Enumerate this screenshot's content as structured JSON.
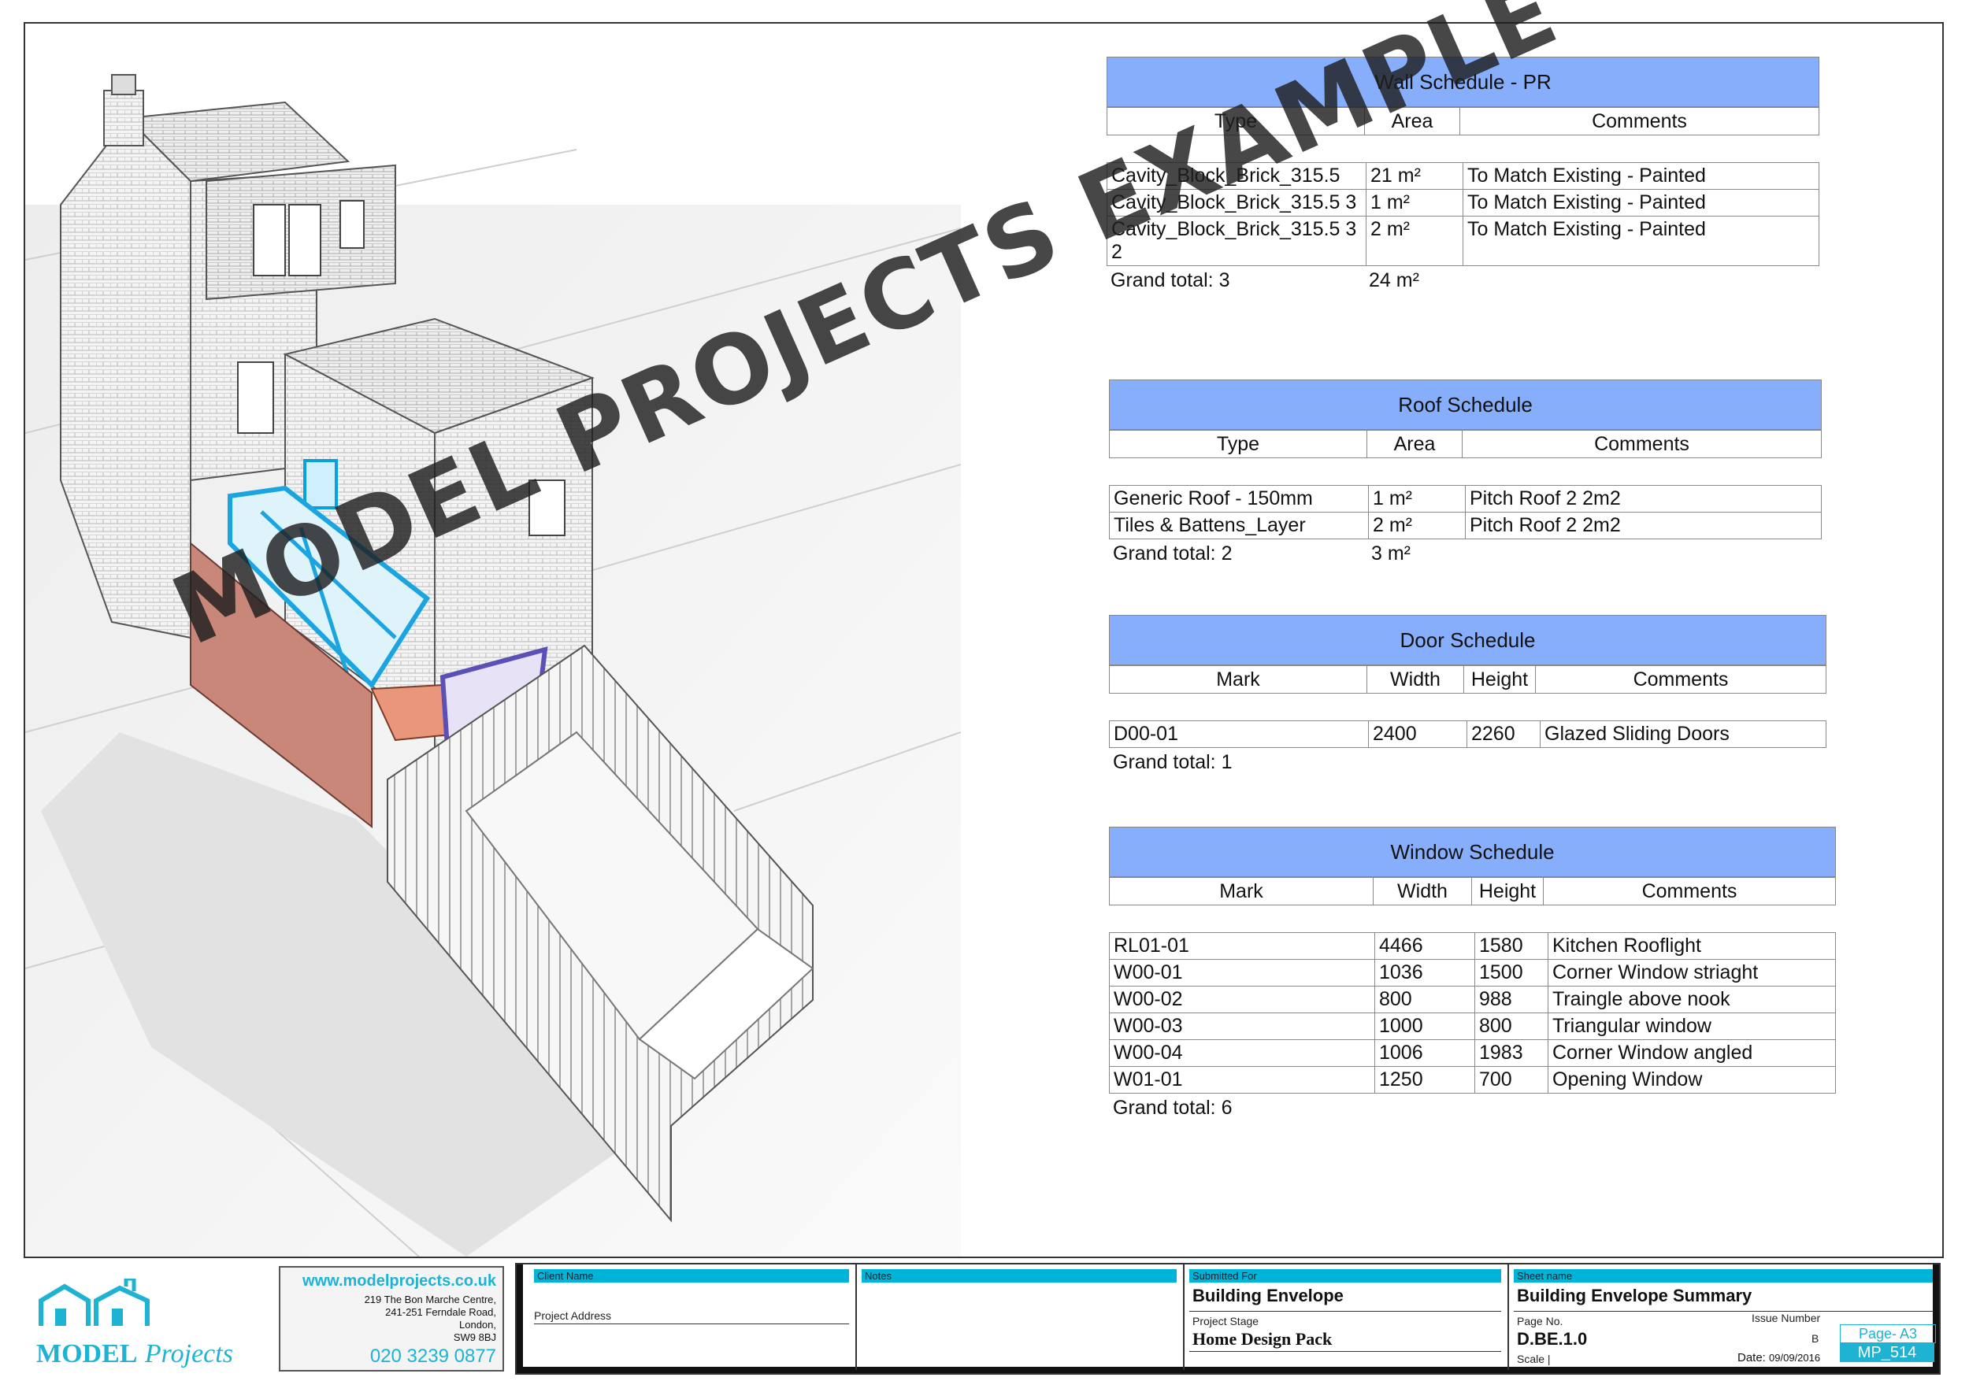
{
  "watermark": "MODEL PROJECTS EXAMPLE",
  "wall_schedule": {
    "title": "Wall Schedule - PR",
    "columns": [
      "Type",
      "Area",
      "Comments"
    ],
    "rows": [
      [
        "Cavity_Block_Brick_315.5",
        "21 m²",
        "To Match Existing - Painted"
      ],
      [
        "Cavity_Block_Brick_315.5 3",
        "1 m²",
        "To Match Existing - Painted"
      ],
      [
        "Cavity_Block_Brick_315.5 3 2",
        "2 m²",
        "To Match Existing - Painted"
      ]
    ],
    "total_label": "Grand total: 3",
    "total_value": "24 m²"
  },
  "roof_schedule": {
    "title": "Roof Schedule",
    "columns": [
      "Type",
      "Area",
      "Comments"
    ],
    "rows": [
      [
        "Generic Roof - 150mm",
        "1 m²",
        "Pitch Roof 2    2m2"
      ],
      [
        "Tiles & Battens_Layer",
        "2 m²",
        "Pitch Roof 2    2m2"
      ]
    ],
    "total_label": "Grand total: 2",
    "total_value": "3 m²"
  },
  "door_schedule": {
    "title": "Door Schedule",
    "columns": [
      "Mark",
      "Width",
      "Height",
      "Comments"
    ],
    "rows": [
      [
        "D00-01",
        "2400",
        "2260",
        "Glazed Sliding Doors"
      ]
    ],
    "total_label": "Grand total: 1"
  },
  "window_schedule": {
    "title": "Window Schedule",
    "columns": [
      "Mark",
      "Width",
      "Height",
      "Comments"
    ],
    "rows": [
      [
        "RL01-01",
        "4466",
        "1580",
        "Kitchen Rooflight"
      ],
      [
        "W00-01",
        "1036",
        "1500",
        "Corner Window striaght"
      ],
      [
        "W00-02",
        "800",
        "988",
        "Traingle above nook"
      ],
      [
        "W00-03",
        "1000",
        "800",
        "Triangular window"
      ],
      [
        "W00-04",
        "1006",
        "1983",
        "Corner Window angled"
      ],
      [
        "W01-01",
        "1250",
        "700",
        "Opening Window"
      ]
    ],
    "total_label": "Grand total: 6"
  },
  "title_block": {
    "logo_word1": "MODEL",
    "logo_word2": "Projects",
    "website": "www.modelprojects.co.uk",
    "address_lines": [
      "219 The Bon Marche Centre,",
      "241-251 Ferndale Road,",
      "London,",
      "SW9 8BJ"
    ],
    "phone": "020 3239 0877",
    "client_name_label": "Client Name",
    "project_address_label": "Project Address",
    "notes_label": "Notes",
    "submitted_for_label": "Submitted For",
    "submitted_for": "Building Envelope",
    "project_stage_label": "Project Stage",
    "project_stage": "Home Design Pack",
    "sheet_name_label": "Sheet name",
    "sheet_name": "Building Envelope Summary",
    "page_no_label": "Page No.",
    "page_no": "D.BE.1.0",
    "issue_number_label": "Issue Number",
    "issue_number": "B",
    "scale_label": "Scale |",
    "date_label": "Date:",
    "date": "09/09/2016",
    "page_size": "Page- A3",
    "project_code": "MP_514",
    "accent_color": "#00b4d8"
  }
}
